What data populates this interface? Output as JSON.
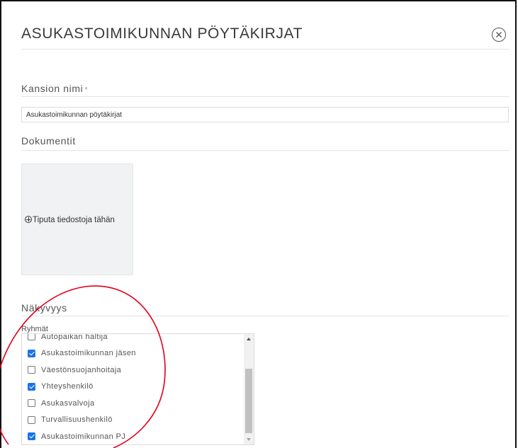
{
  "dialog": {
    "title": "ASUKASTOIMIKUNNAN PÖYTÄKIRJAT"
  },
  "folder_name": {
    "label": "Kansion nimi",
    "required_marker": "*",
    "value": "Asukastoimikunnan pöytäkirjat"
  },
  "documents": {
    "label": "Dokumentit",
    "dropzone_text": "Tiputa tiedostoja tähän"
  },
  "visibility": {
    "label": "Näkyvyys",
    "groups_label": "Ryhmät",
    "groups": [
      {
        "label": "Autopaikan haltija",
        "checked": false
      },
      {
        "label": "Asukastoimikunnan jäsen",
        "checked": true
      },
      {
        "label": "Väestönsuojanhoitaja",
        "checked": false
      },
      {
        "label": "Yhteyshenkilö",
        "checked": true
      },
      {
        "label": "Asukasvalvoja",
        "checked": false
      },
      {
        "label": "Turvallisuushenkilö",
        "checked": false
      },
      {
        "label": "Asukastoimikunnan PJ",
        "checked": true
      }
    ]
  },
  "colors": {
    "accent": "#1a73e8",
    "annotation": "#e0001b"
  },
  "icons": {
    "close": "close-circle-icon",
    "dropzone": "plus-circle-icon"
  }
}
